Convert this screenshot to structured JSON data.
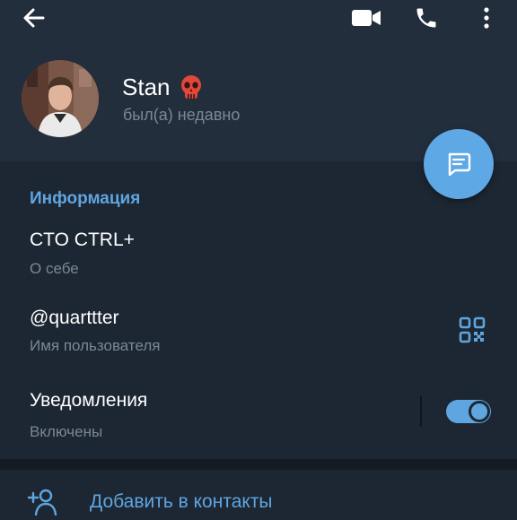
{
  "header": {
    "name": "Stan",
    "status": "был(а) недавно"
  },
  "info": {
    "title": "Информация",
    "bio_value": "CTO CTRL+",
    "bio_label": "О себе",
    "username_value": "@quarttter",
    "username_label": "Имя пользователя",
    "notifications_value": "Уведомления",
    "notifications_label": "Включены",
    "notifications_on": true
  },
  "actions": {
    "add_contact": "Добавить в контакты"
  },
  "icons": {
    "back": "arrow-left-icon",
    "video": "video-call-icon",
    "call": "phone-icon",
    "more": "more-vertical-icon",
    "message": "message-icon",
    "qr": "qr-code-icon",
    "add_contact": "add-user-icon",
    "emoji": "skull-emoji"
  },
  "colors": {
    "accent": "#5fa5e0",
    "background": "#1d2733",
    "header": "#232e3c",
    "muted": "#7b8896"
  }
}
